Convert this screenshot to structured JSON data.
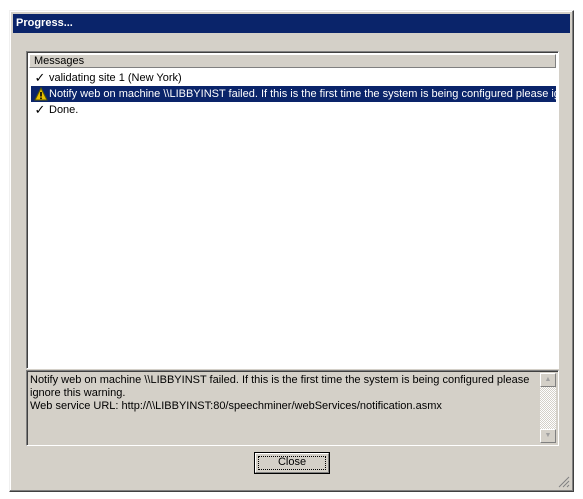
{
  "window": {
    "title": "Progress..."
  },
  "list": {
    "column_header": "Messages",
    "rows": [
      {
        "icon": "checkmark-icon",
        "text": "validating site 1 (New York)",
        "selected": false
      },
      {
        "icon": "warning-icon",
        "text": "Notify web on machine \\\\LIBBYINST failed. If this is the first time the system is being configured please ig...",
        "selected": true
      },
      {
        "icon": "checkmark-icon",
        "text": "Done.",
        "selected": false
      }
    ]
  },
  "detail": {
    "text": "Notify web on machine \\\\LIBBYINST failed. If this is the first time the system is being configured please\nignore this warning.\nWeb service URL: http://\\\\LIBBYINST:80/speechminer/webServices/notification.asmx"
  },
  "buttons": {
    "close_label": "Close"
  },
  "colors": {
    "titlebar": "#0a246a",
    "selection": "#0a246a",
    "face": "#d4d0c8"
  }
}
